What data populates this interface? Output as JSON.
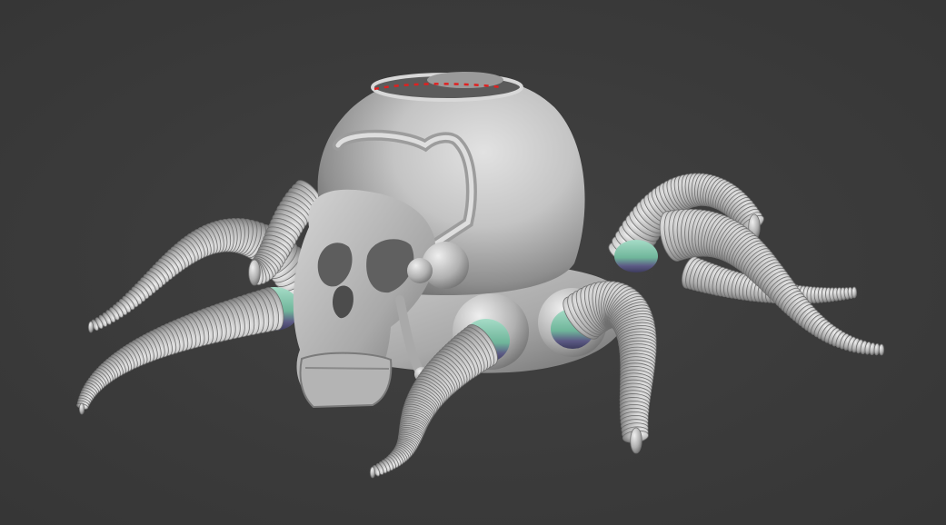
{
  "viewport": {
    "background_color": "#3c3c3c",
    "model_color": "#b9b9b9",
    "joint_color_teal": "#6fb59a",
    "joint_color_purple": "#5c5a85",
    "edge_marker_color": "#e02020"
  },
  "scene": {
    "object": "skull-octopus-sculpt",
    "parts": [
      "dome-head",
      "skull-face",
      "tentacles",
      "joints",
      "open-rim"
    ]
  }
}
